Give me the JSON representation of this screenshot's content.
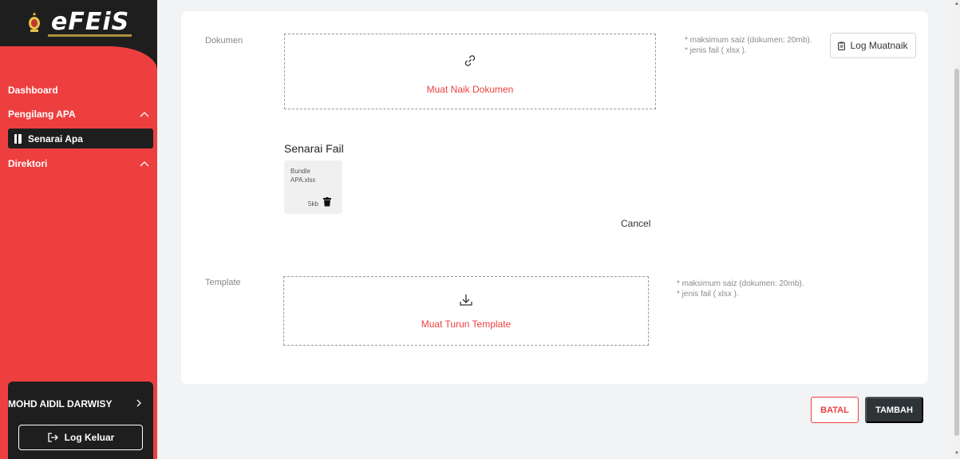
{
  "sidebar": {
    "logo_text_main": "eFEiS",
    "nav": {
      "dashboard": "Dashboard",
      "pengilang": "Pengilang APA",
      "senarai": "Senarai Apa",
      "direktori": "Direktori"
    },
    "user_name": "MOHD AIDIL DARWISY",
    "logout_label": "Log Keluar"
  },
  "form": {
    "dokumen": {
      "label": "Dokumen",
      "upload_text": "Muat Naik Dokumen",
      "hint_line1": "* maksimum saiz (dokumen: 20mb).",
      "hint_line2": "* jenis fail ( xlsx ).",
      "log_button": "Log Muatnaik"
    },
    "file_list": {
      "title": "Senarai Fail",
      "files": [
        {
          "name_line1": "Bundle",
          "name_line2": "APA.xlsx",
          "size": "5kb"
        }
      ],
      "cancel_label": "Cancel"
    },
    "template": {
      "label": "Template",
      "download_text": "Muat Turun Template",
      "hint_line1": "* maksimum saiz (dokumen: 20mb).",
      "hint_line2": "* jenis fail ( xlsx )."
    }
  },
  "actions": {
    "batal": "BATAL",
    "tambah": "TAMBAH"
  },
  "colors": {
    "accent": "#ed3f3f",
    "dark": "#1e1e1e",
    "button_dark": "#2e3338"
  }
}
